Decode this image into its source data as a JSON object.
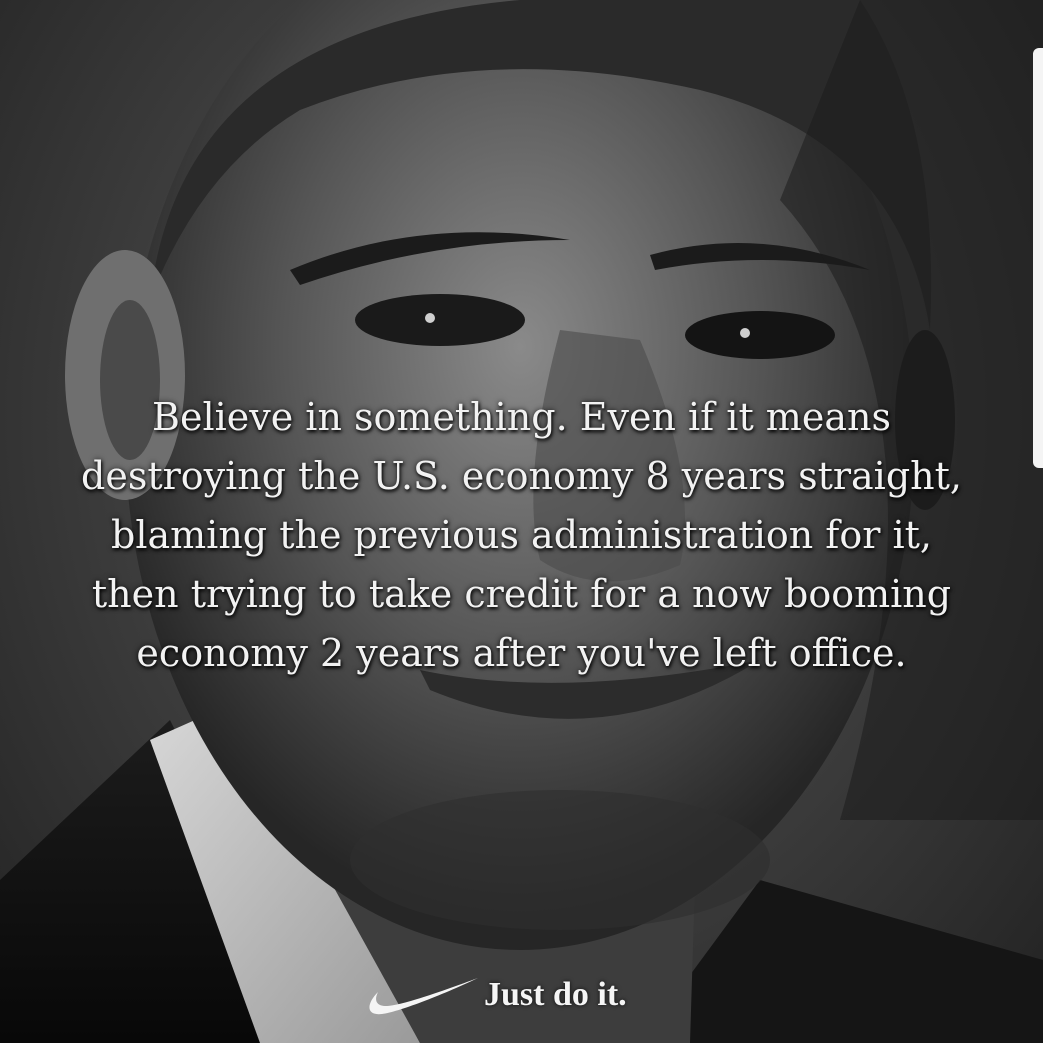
{
  "quote": {
    "lines": [
      "Believe in something. Even if it means",
      "destroying the U.S. economy 8 years straight,",
      "blaming the previous administration for it,",
      "then trying to take credit for a now booming",
      "economy 2 years after you've left office."
    ]
  },
  "brand": {
    "logo_icon": "swoosh-logo-icon",
    "tagline": "Just do it."
  },
  "colors": {
    "text": "#f2f2f2",
    "background": "#3a3a3a"
  }
}
